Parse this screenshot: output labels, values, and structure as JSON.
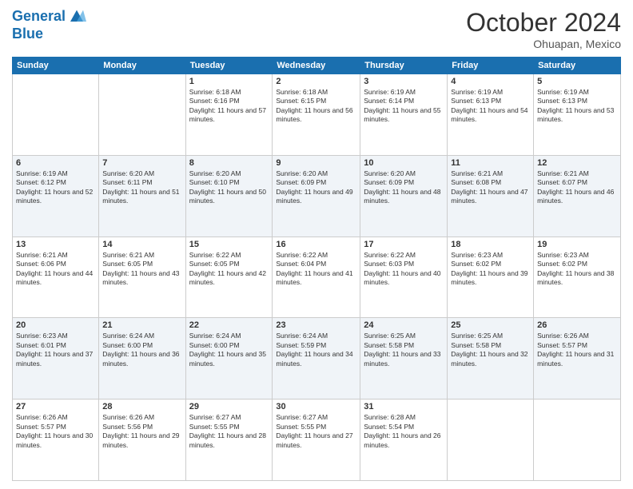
{
  "logo": {
    "line1": "General",
    "line2": "Blue"
  },
  "header": {
    "month": "October 2024",
    "location": "Ohuapan, Mexico"
  },
  "weekdays": [
    "Sunday",
    "Monday",
    "Tuesday",
    "Wednesday",
    "Thursday",
    "Friday",
    "Saturday"
  ],
  "weeks": [
    [
      {
        "day": "",
        "sunrise": "",
        "sunset": "",
        "daylight": ""
      },
      {
        "day": "",
        "sunrise": "",
        "sunset": "",
        "daylight": ""
      },
      {
        "day": "1",
        "sunrise": "Sunrise: 6:18 AM",
        "sunset": "Sunset: 6:16 PM",
        "daylight": "Daylight: 11 hours and 57 minutes."
      },
      {
        "day": "2",
        "sunrise": "Sunrise: 6:18 AM",
        "sunset": "Sunset: 6:15 PM",
        "daylight": "Daylight: 11 hours and 56 minutes."
      },
      {
        "day": "3",
        "sunrise": "Sunrise: 6:19 AM",
        "sunset": "Sunset: 6:14 PM",
        "daylight": "Daylight: 11 hours and 55 minutes."
      },
      {
        "day": "4",
        "sunrise": "Sunrise: 6:19 AM",
        "sunset": "Sunset: 6:13 PM",
        "daylight": "Daylight: 11 hours and 54 minutes."
      },
      {
        "day": "5",
        "sunrise": "Sunrise: 6:19 AM",
        "sunset": "Sunset: 6:13 PM",
        "daylight": "Daylight: 11 hours and 53 minutes."
      }
    ],
    [
      {
        "day": "6",
        "sunrise": "Sunrise: 6:19 AM",
        "sunset": "Sunset: 6:12 PM",
        "daylight": "Daylight: 11 hours and 52 minutes."
      },
      {
        "day": "7",
        "sunrise": "Sunrise: 6:20 AM",
        "sunset": "Sunset: 6:11 PM",
        "daylight": "Daylight: 11 hours and 51 minutes."
      },
      {
        "day": "8",
        "sunrise": "Sunrise: 6:20 AM",
        "sunset": "Sunset: 6:10 PM",
        "daylight": "Daylight: 11 hours and 50 minutes."
      },
      {
        "day": "9",
        "sunrise": "Sunrise: 6:20 AM",
        "sunset": "Sunset: 6:09 PM",
        "daylight": "Daylight: 11 hours and 49 minutes."
      },
      {
        "day": "10",
        "sunrise": "Sunrise: 6:20 AM",
        "sunset": "Sunset: 6:09 PM",
        "daylight": "Daylight: 11 hours and 48 minutes."
      },
      {
        "day": "11",
        "sunrise": "Sunrise: 6:21 AM",
        "sunset": "Sunset: 6:08 PM",
        "daylight": "Daylight: 11 hours and 47 minutes."
      },
      {
        "day": "12",
        "sunrise": "Sunrise: 6:21 AM",
        "sunset": "Sunset: 6:07 PM",
        "daylight": "Daylight: 11 hours and 46 minutes."
      }
    ],
    [
      {
        "day": "13",
        "sunrise": "Sunrise: 6:21 AM",
        "sunset": "Sunset: 6:06 PM",
        "daylight": "Daylight: 11 hours and 44 minutes."
      },
      {
        "day": "14",
        "sunrise": "Sunrise: 6:21 AM",
        "sunset": "Sunset: 6:05 PM",
        "daylight": "Daylight: 11 hours and 43 minutes."
      },
      {
        "day": "15",
        "sunrise": "Sunrise: 6:22 AM",
        "sunset": "Sunset: 6:05 PM",
        "daylight": "Daylight: 11 hours and 42 minutes."
      },
      {
        "day": "16",
        "sunrise": "Sunrise: 6:22 AM",
        "sunset": "Sunset: 6:04 PM",
        "daylight": "Daylight: 11 hours and 41 minutes."
      },
      {
        "day": "17",
        "sunrise": "Sunrise: 6:22 AM",
        "sunset": "Sunset: 6:03 PM",
        "daylight": "Daylight: 11 hours and 40 minutes."
      },
      {
        "day": "18",
        "sunrise": "Sunrise: 6:23 AM",
        "sunset": "Sunset: 6:02 PM",
        "daylight": "Daylight: 11 hours and 39 minutes."
      },
      {
        "day": "19",
        "sunrise": "Sunrise: 6:23 AM",
        "sunset": "Sunset: 6:02 PM",
        "daylight": "Daylight: 11 hours and 38 minutes."
      }
    ],
    [
      {
        "day": "20",
        "sunrise": "Sunrise: 6:23 AM",
        "sunset": "Sunset: 6:01 PM",
        "daylight": "Daylight: 11 hours and 37 minutes."
      },
      {
        "day": "21",
        "sunrise": "Sunrise: 6:24 AM",
        "sunset": "Sunset: 6:00 PM",
        "daylight": "Daylight: 11 hours and 36 minutes."
      },
      {
        "day": "22",
        "sunrise": "Sunrise: 6:24 AM",
        "sunset": "Sunset: 6:00 PM",
        "daylight": "Daylight: 11 hours and 35 minutes."
      },
      {
        "day": "23",
        "sunrise": "Sunrise: 6:24 AM",
        "sunset": "Sunset: 5:59 PM",
        "daylight": "Daylight: 11 hours and 34 minutes."
      },
      {
        "day": "24",
        "sunrise": "Sunrise: 6:25 AM",
        "sunset": "Sunset: 5:58 PM",
        "daylight": "Daylight: 11 hours and 33 minutes."
      },
      {
        "day": "25",
        "sunrise": "Sunrise: 6:25 AM",
        "sunset": "Sunset: 5:58 PM",
        "daylight": "Daylight: 11 hours and 32 minutes."
      },
      {
        "day": "26",
        "sunrise": "Sunrise: 6:26 AM",
        "sunset": "Sunset: 5:57 PM",
        "daylight": "Daylight: 11 hours and 31 minutes."
      }
    ],
    [
      {
        "day": "27",
        "sunrise": "Sunrise: 6:26 AM",
        "sunset": "Sunset: 5:57 PM",
        "daylight": "Daylight: 11 hours and 30 minutes."
      },
      {
        "day": "28",
        "sunrise": "Sunrise: 6:26 AM",
        "sunset": "Sunset: 5:56 PM",
        "daylight": "Daylight: 11 hours and 29 minutes."
      },
      {
        "day": "29",
        "sunrise": "Sunrise: 6:27 AM",
        "sunset": "Sunset: 5:55 PM",
        "daylight": "Daylight: 11 hours and 28 minutes."
      },
      {
        "day": "30",
        "sunrise": "Sunrise: 6:27 AM",
        "sunset": "Sunset: 5:55 PM",
        "daylight": "Daylight: 11 hours and 27 minutes."
      },
      {
        "day": "31",
        "sunrise": "Sunrise: 6:28 AM",
        "sunset": "Sunset: 5:54 PM",
        "daylight": "Daylight: 11 hours and 26 minutes."
      },
      {
        "day": "",
        "sunrise": "",
        "sunset": "",
        "daylight": ""
      },
      {
        "day": "",
        "sunrise": "",
        "sunset": "",
        "daylight": ""
      }
    ]
  ]
}
